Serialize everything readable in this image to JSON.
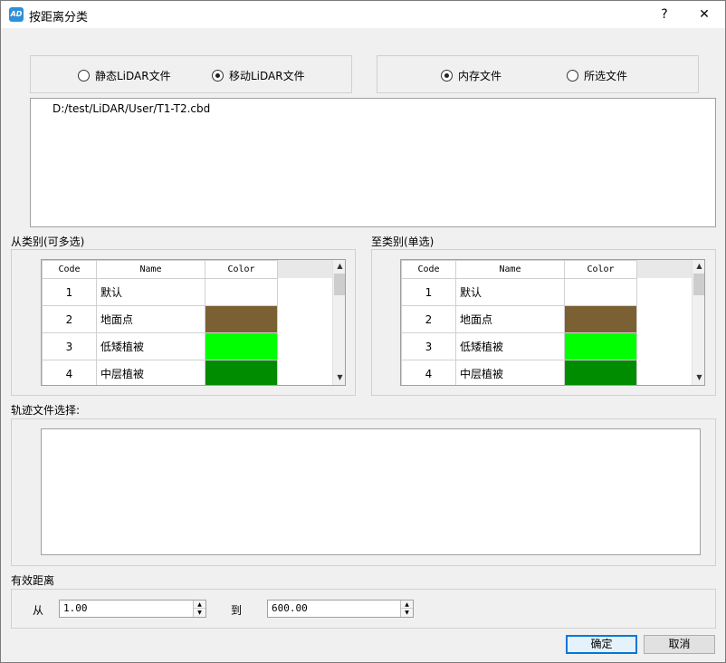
{
  "window": {
    "icon_text": "AD",
    "title": "按距离分类",
    "help_label": "?",
    "close_label": "✕"
  },
  "source": {
    "options": [
      {
        "label": "静态LiDAR文件",
        "selected": false
      },
      {
        "label": "移动LiDAR文件",
        "selected": true
      }
    ]
  },
  "file_scope": {
    "options": [
      {
        "label": "内存文件",
        "selected": true
      },
      {
        "label": "所选文件",
        "selected": false
      }
    ]
  },
  "file_list": {
    "items": [
      "D:/test/LiDAR/User/T1-T2.cbd"
    ]
  },
  "from_class": {
    "label": "从类别(可多选)",
    "columns": [
      "Code",
      "Name",
      "Color"
    ],
    "rows": [
      {
        "code": "1",
        "name": "默认",
        "color": "#ffffff"
      },
      {
        "code": "2",
        "name": "地面点",
        "color": "#7a6033"
      },
      {
        "code": "3",
        "name": "低矮植被",
        "color": "#00ff00"
      },
      {
        "code": "4",
        "name": "中层植被",
        "color": "#008c00"
      }
    ]
  },
  "to_class": {
    "label": "至类别(单选)",
    "columns": [
      "Code",
      "Name",
      "Color"
    ],
    "rows": [
      {
        "code": "1",
        "name": "默认",
        "color": "#ffffff"
      },
      {
        "code": "2",
        "name": "地面点",
        "color": "#7a6033"
      },
      {
        "code": "3",
        "name": "低矮植被",
        "color": "#00ff00"
      },
      {
        "code": "4",
        "name": "中层植被",
        "color": "#008c00"
      }
    ]
  },
  "trajectory": {
    "label": "轨迹文件选择:"
  },
  "distance": {
    "label": "有效距离",
    "from_label": "从",
    "from_value": "1.00",
    "to_label": "到",
    "to_value": "600.00"
  },
  "footer": {
    "ok_label": "确定",
    "cancel_label": "取消"
  },
  "icons": {
    "scroll_up": "▲",
    "scroll_down": "▼"
  }
}
